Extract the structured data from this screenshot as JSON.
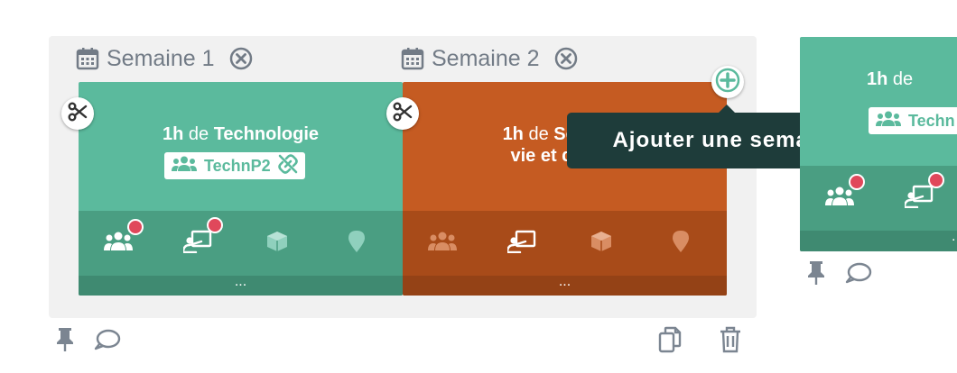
{
  "weeks": [
    {
      "label": "Semaine 1",
      "card": {
        "hours": "1h",
        "prefix": "de",
        "subject_line1": "Technologie",
        "tag": "TechnP2",
        "color": "#5bba9d",
        "icons": [
          "group-icon",
          "classroom-icon",
          "box-icon",
          "location-icon"
        ],
        "badges": [
          "group-icon",
          "classroom-icon"
        ],
        "more": "..."
      }
    },
    {
      "label": "Semaine 2",
      "card": {
        "hours": "1h",
        "prefix": "de",
        "subject_line1": "Scie",
        "subject_line2": "vie et de",
        "color": "#c55b22",
        "icons": [
          "group-icon",
          "classroom-icon",
          "box-icon",
          "location-icon"
        ],
        "more": "..."
      }
    }
  ],
  "tooltip": {
    "text": "Ajouter une semaine"
  },
  "side_card": {
    "hours": "1h",
    "prefix": "de",
    "tag_partial": "Techn",
    "more": "."
  },
  "colors": {
    "green": "#5bba9d",
    "orange": "#c55b22",
    "tooltip_bg": "#1e3c3a",
    "badge": "#e0485b",
    "text_gray": "#727b86"
  }
}
